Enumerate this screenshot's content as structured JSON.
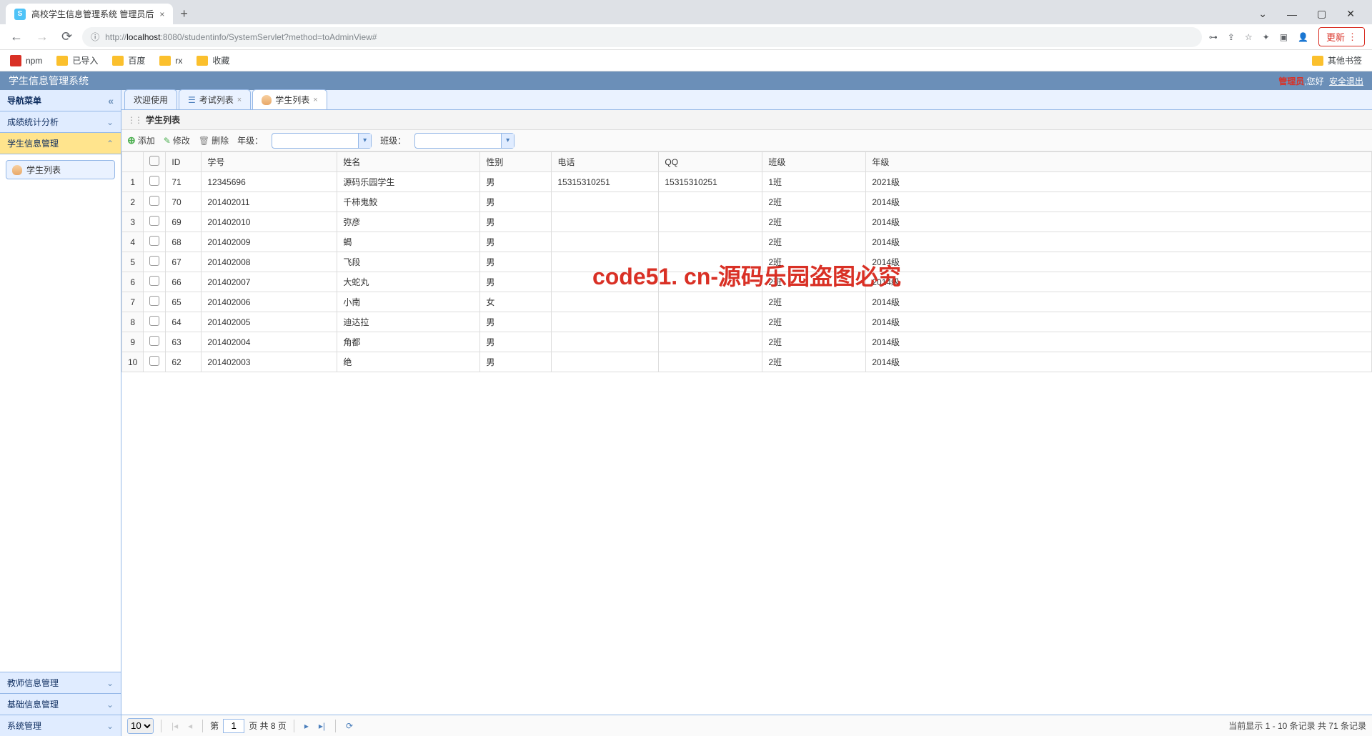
{
  "browser": {
    "tab_title": "高校学生信息管理系统 管理员后",
    "url_host": "localhost",
    "url_port": ":8080",
    "url_path": "/studentinfo/SystemServlet?method=toAdminView#",
    "update_label": "更新"
  },
  "bookmarks": {
    "items": [
      "npm",
      "已导入",
      "百度",
      "rx",
      "收藏"
    ],
    "other": "其他书签"
  },
  "app": {
    "title": "学生信息管理系统",
    "role": "管理员",
    "greeting": ",您好",
    "logout": "安全退出"
  },
  "sidebar": {
    "title": "导航菜单",
    "sections": {
      "stats": "成绩统计分析",
      "student": "学生信息管理",
      "teacher": "教师信息管理",
      "base": "基础信息管理",
      "system": "系统管理"
    },
    "student_list_node": "学生列表"
  },
  "tabs": {
    "welcome": "欢迎使用",
    "exam": "考试列表",
    "student": "学生列表"
  },
  "panel": {
    "title": "学生列表"
  },
  "toolbar": {
    "add": "添加",
    "edit": "修改",
    "delete": "删除",
    "grade_label": "年级：",
    "class_label": "班级："
  },
  "table": {
    "headers": {
      "id": "ID",
      "sno": "学号",
      "name": "姓名",
      "sex": "性别",
      "phone": "电话",
      "qq": "QQ",
      "class": "班级",
      "grade": "年级"
    },
    "rows": [
      {
        "n": 1,
        "id": "71",
        "sno": "12345696",
        "name": "源码乐园学生",
        "sex": "男",
        "phone": "15315310251",
        "qq": "15315310251",
        "class": "1班",
        "grade": "2021级"
      },
      {
        "n": 2,
        "id": "70",
        "sno": "201402011",
        "name": "千柿鬼鲛",
        "sex": "男",
        "phone": "",
        "qq": "",
        "class": "2班",
        "grade": "2014级"
      },
      {
        "n": 3,
        "id": "69",
        "sno": "201402010",
        "name": "弥彦",
        "sex": "男",
        "phone": "",
        "qq": "",
        "class": "2班",
        "grade": "2014级"
      },
      {
        "n": 4,
        "id": "68",
        "sno": "201402009",
        "name": "蝎",
        "sex": "男",
        "phone": "",
        "qq": "",
        "class": "2班",
        "grade": "2014级"
      },
      {
        "n": 5,
        "id": "67",
        "sno": "201402008",
        "name": "飞段",
        "sex": "男",
        "phone": "",
        "qq": "",
        "class": "2班",
        "grade": "2014级"
      },
      {
        "n": 6,
        "id": "66",
        "sno": "201402007",
        "name": "大蛇丸",
        "sex": "男",
        "phone": "",
        "qq": "",
        "class": "2班",
        "grade": "2014级"
      },
      {
        "n": 7,
        "id": "65",
        "sno": "201402006",
        "name": "小南",
        "sex": "女",
        "phone": "",
        "qq": "",
        "class": "2班",
        "grade": "2014级"
      },
      {
        "n": 8,
        "id": "64",
        "sno": "201402005",
        "name": "迪达拉",
        "sex": "男",
        "phone": "",
        "qq": "",
        "class": "2班",
        "grade": "2014级"
      },
      {
        "n": 9,
        "id": "63",
        "sno": "201402004",
        "name": "角都",
        "sex": "男",
        "phone": "",
        "qq": "",
        "class": "2班",
        "grade": "2014级"
      },
      {
        "n": 10,
        "id": "62",
        "sno": "201402003",
        "name": "绝",
        "sex": "男",
        "phone": "",
        "qq": "",
        "class": "2班",
        "grade": "2014级"
      }
    ]
  },
  "watermark": "code51. cn-源码乐园盗图必究",
  "pager": {
    "page_size": "10",
    "page_prefix": "第",
    "current_page": "1",
    "page_suffix": "页 共 8 页",
    "info": "当前显示 1 - 10 条记录 共 71 条记录"
  }
}
